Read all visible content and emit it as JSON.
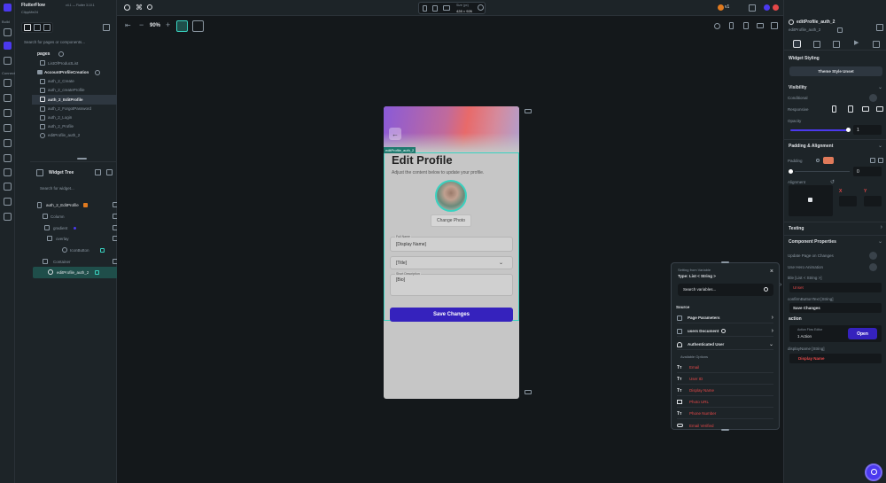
{
  "app": {
    "name": "FlutterFlow",
    "version": "v4.1 — Flutter 3.10.1",
    "project": "ClippMe24"
  },
  "rail": {
    "build_label": "Build",
    "connect_label": "Connect"
  },
  "pages_panel": {
    "search_placeholder": "Search for pages or components...",
    "pages_label": "pages",
    "pages": [
      {
        "label": "ListOfProductList"
      }
    ],
    "folder_label": "AccountProfileCreation",
    "items": [
      {
        "label": "auth_2_Create"
      },
      {
        "label": "auth_2_createProfile"
      },
      {
        "label": "auth_2_EditProfile"
      },
      {
        "label": "auth_2_ForgotPassword"
      },
      {
        "label": "auth_2_Login"
      },
      {
        "label": "auth_2_Profile"
      },
      {
        "label": "editProfile_auth_2"
      }
    ]
  },
  "widget_tree": {
    "title": "Widget Tree",
    "search_placeholder": "Search for widget...",
    "nodes": [
      {
        "label": "auth_2_EditProfile"
      },
      {
        "label": "Column"
      },
      {
        "label": "gradient"
      },
      {
        "label": "overlay"
      },
      {
        "label": "IconButton"
      },
      {
        "label": "Container"
      },
      {
        "label": "editProfile_auth_2"
      }
    ]
  },
  "toolbar": {
    "zoom": "90%",
    "size_label": "Size (px)",
    "size_value": "428 × 926",
    "version_badge": "v1"
  },
  "phone": {
    "component_tag": "editProfile_auth_2",
    "title": "Edit Profile",
    "subtitle": "Adjust the content below to update your profile.",
    "change_photo": "Change Photo",
    "full_name_label": "Full Name",
    "full_name_value": "[Display Name]",
    "title_value": "[Title]",
    "short_desc_label": "Short Description",
    "bio_value": "[Bio]",
    "save_button": "Save Changes"
  },
  "variable_picker": {
    "header": "Setting from Variable",
    "type_label": "Type: List < String >",
    "search_placeholder": "Search variables...",
    "source_label": "Source",
    "sources": [
      {
        "label": "Page Parameters"
      },
      {
        "label": "users Document"
      },
      {
        "label": "Authenticated User"
      }
    ],
    "available_label": "Available Options",
    "options": [
      {
        "label": "Email"
      },
      {
        "label": "User ID"
      },
      {
        "label": "Display Name"
      },
      {
        "label": "Photo URL"
      },
      {
        "label": "Phone Number"
      },
      {
        "label": "Email Verified"
      }
    ]
  },
  "props_panel": {
    "component_name": "editProfile_auth_2",
    "component_sub": "editProfile_auth_2",
    "widget_styling": "Widget Styling",
    "theme_style": "Theme Style Unset",
    "visibility": "Visibility",
    "conditional": "Conditional",
    "responsive": "Responsive",
    "opacity": "Opacity",
    "opacity_value": "1",
    "padding_alignment": "Padding & Alignment",
    "padding": "Padding",
    "padding_value": "0",
    "alignment": "Alignment",
    "x_label": "X",
    "y_label": "Y",
    "testing": "Testing",
    "component_properties": "Component Properties",
    "update_page": "Update Page on Changes",
    "use_hero": "Use Hero Animation",
    "title_param": "title  [List < String >]",
    "title_unset": "Unset",
    "confirm_param": "confirmButtonText  [String]",
    "confirm_value": "Save Changes",
    "action_label": "action",
    "action_flow": "Action Flow Editor",
    "action_count": "1 Action",
    "open_button": "Open",
    "display_name_param": "displayName  [String]",
    "display_name_value": "Display Name"
  },
  "colors": {
    "accent": "#4b39ef",
    "panel": "#1d2428",
    "canvas": "#14181b",
    "error": "#e54848"
  }
}
